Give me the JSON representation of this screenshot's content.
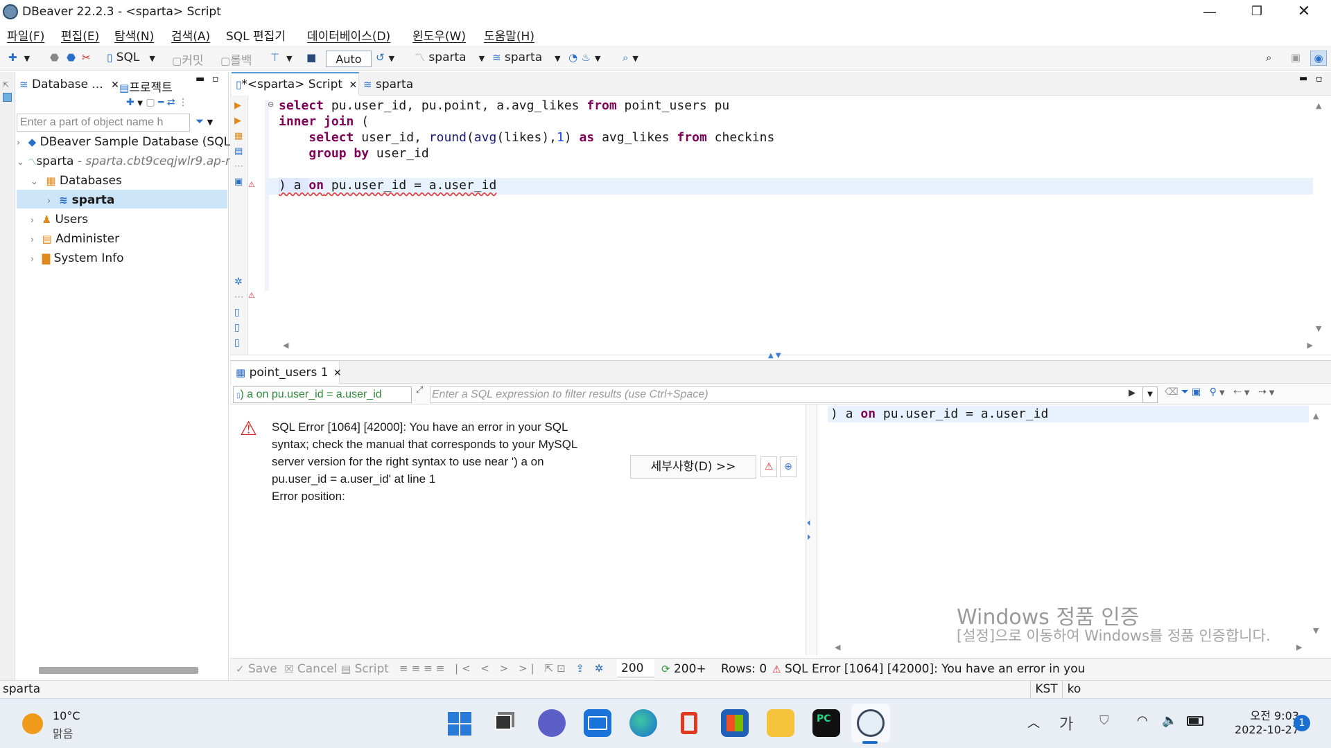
{
  "window": {
    "title": "DBeaver 22.2.3 - <sparta> Script"
  },
  "menu": [
    "파일(F)",
    "편집(E)",
    "탐색(N)",
    "검색(A)",
    "SQL 편집기",
    "데이터베이스(D)",
    "윈도우(W)",
    "도움말(H)"
  ],
  "toolbar": {
    "sql": "SQL",
    "commit": "커밋",
    "rollback": "롤백",
    "auto": "Auto",
    "datasource": "sparta",
    "schema": "sparta"
  },
  "left_panel": {
    "tab_database": "Database ...",
    "tab_project": "프로젝트",
    "filter_placeholder": "Enter a part of object name h",
    "tree": [
      {
        "label": "DBeaver Sample Database (SQLi"
      },
      {
        "label": "sparta",
        "sub": " - sparta.cbt9ceqjwlr9.ap-r"
      },
      {
        "label": "Databases"
      },
      {
        "label": "sparta"
      },
      {
        "label": "Users"
      },
      {
        "label": "Administer"
      },
      {
        "label": "System Info"
      }
    ],
    "status": "sparta"
  },
  "editor": {
    "tab_script": "*<sparta> Script",
    "tab_sparta": "sparta"
  },
  "code": {
    "l1": {
      "k1": "select",
      "t1": " pu.user_id, pu.point, a.avg_likes ",
      "k2": "from",
      "t2": " point_users pu"
    },
    "l2": {
      "k1": "inner join",
      "t1": " ("
    },
    "l3": {
      "k1": "select",
      "t1": " user_id, ",
      "f1": "round",
      "t2": "(",
      "f2": "avg",
      "t3": "(likes),",
      "n1": "1",
      "t4": ") ",
      "k2": "as",
      "t5": " avg_likes ",
      "k3": "from",
      "t6": " checkins"
    },
    "l4": {
      "k1": "group by",
      "t1": " user_id"
    },
    "l6": {
      "t1": ") a ",
      "k1": "on",
      "t2": " pu.user_id = a.user_id"
    }
  },
  "results": {
    "tab": "point_users 1",
    "query_label": ") a on pu.user_id = a.user_id",
    "filter_placeholder": "Enter a SQL expression to filter results (use Ctrl+Space)",
    "error_lines": [
      "SQL Error [1064] [42000]: You have an error in your SQL",
      "syntax; check the manual that corresponds to your MySQL",
      "server version for the right syntax to use near ') a on",
      "pu.user_id = a.user_id' at line 1",
      "Error position:"
    ],
    "details_button": "세부사항(D) >>",
    "sql_preview": {
      "t1": ") a ",
      "k1": "on",
      "t2": " pu.user_id = a.user_id"
    }
  },
  "result_toolbar": {
    "save": "Save",
    "cancel": "Cancel",
    "script": "Script",
    "fetch_size": "200",
    "fetch_more": "200+",
    "rows": "Rows: 0",
    "error": "SQL Error [1064] [42000]: You have an error in your"
  },
  "status_bar": {
    "timezone": "KST",
    "locale": "ko"
  },
  "watermark": {
    "line1": "Windows 정품 인증",
    "line2": "[설정]으로 이동하여 Windows를 정품 인증합니다."
  },
  "taskbar": {
    "temperature": "10°C",
    "weather": "맑음",
    "ime": "가",
    "time": "오전 9:03",
    "date": "2022-10-27",
    "notifications": "1"
  }
}
